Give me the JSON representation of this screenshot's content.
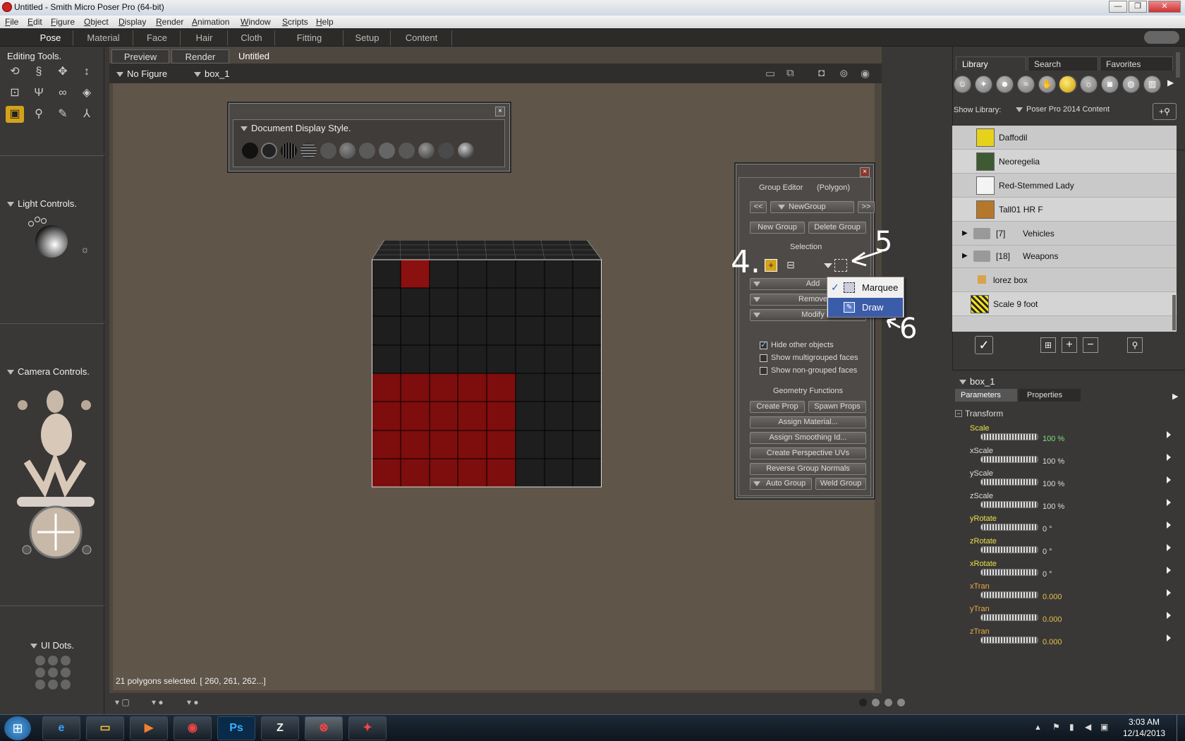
{
  "window": {
    "title": "Untitled - Smith Micro Poser Pro  (64-bit)"
  },
  "menu": [
    "File",
    "Edit",
    "Figure",
    "Object",
    "Display",
    "Render",
    "Animation",
    "Window",
    "Scripts",
    "Help"
  ],
  "rooms": [
    "Pose",
    "Material",
    "Face",
    "Hair",
    "Cloth",
    "Fitting",
    "Setup",
    "Content"
  ],
  "left": {
    "editing_tools": "Editing Tools.",
    "light_controls": "Light Controls.",
    "camera_controls": "Camera Controls.",
    "ui_dots": "UI Dots."
  },
  "doc": {
    "tabs": [
      "Preview",
      "Render"
    ],
    "title": "Untitled",
    "figure_select": "No Figure",
    "actor_select": "box_1",
    "status": "21 polygons selected.  [ 260, 261, 262...]"
  },
  "display_style": {
    "title": "Document Display Style."
  },
  "group_editor": {
    "title": "Group Editor",
    "mode": "(Polygon)",
    "prev": "<<",
    "next": ">>",
    "group": "NewGroup",
    "new_group": "New Group",
    "delete_group": "Delete Group",
    "selection": "Selection",
    "add": "Add",
    "remove": "Remove",
    "modify": "Modify",
    "hide_other": "Hide other objects",
    "show_multi": "Show multigrouped faces",
    "show_nongrouped": "Show non-grouped faces",
    "geometry_functions": "Geometry Functions",
    "create_prop": "Create Prop",
    "spawn_props": "Spawn Props",
    "assign_material": "Assign Material...",
    "assign_smoothing": "Assign Smoothing Id...",
    "create_uvs": "Create Perspective UVs",
    "reverse_normals": "Reverse Group Normals",
    "auto_group": "Auto Group",
    "weld_group": "Weld Group"
  },
  "context_menu": {
    "items": [
      "Marquee",
      "Draw"
    ],
    "checked": "Marquee",
    "highlighted": "Draw"
  },
  "annotations": [
    "4.",
    "5",
    "6"
  ],
  "library": {
    "tabs": [
      "Library",
      "Search",
      "Favorites"
    ],
    "show_label": "Show Library:",
    "source": "Poser Pro 2014 Content",
    "items": [
      {
        "name": "Daffodil"
      },
      {
        "name": "Neoregelia"
      },
      {
        "name": "Red-Stemmed Lady"
      },
      {
        "name": "Tall01 HR F"
      },
      {
        "count": "[7]",
        "name": "Vehicles"
      },
      {
        "count": "[18]",
        "name": "Weapons"
      },
      {
        "name": "lorez box"
      },
      {
        "name": "Scale 9 foot"
      }
    ]
  },
  "params": {
    "actor": "box_1",
    "tabs": [
      "Parameters",
      "Properties"
    ],
    "group": "Transform",
    "items": [
      {
        "name": "Scale",
        "value": "100 %"
      },
      {
        "name": "xScale",
        "value": "100 %"
      },
      {
        "name": "yScale",
        "value": "100 %"
      },
      {
        "name": "zScale",
        "value": "100 %"
      },
      {
        "name": "yRotate",
        "value": "0 °"
      },
      {
        "name": "zRotate",
        "value": "0 °"
      },
      {
        "name": "xRotate",
        "value": "0 °"
      },
      {
        "name": "xTran",
        "value": "0.000"
      },
      {
        "name": "yTran",
        "value": "0.000"
      },
      {
        "name": "zTran",
        "value": "0.000"
      }
    ]
  },
  "taskbar": {
    "time": "3:03 AM",
    "date": "12/14/2013"
  }
}
